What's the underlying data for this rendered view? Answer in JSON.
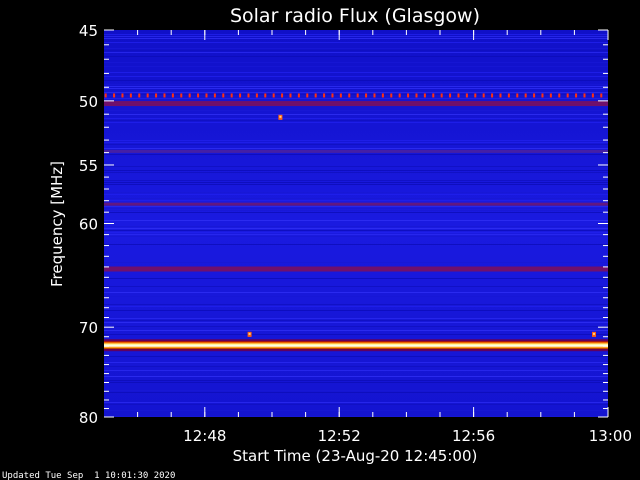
{
  "chart_data": {
    "type": "heatmap",
    "title": "Solar radio Flux (Glasgow)",
    "xlabel": "Start Time (23-Aug-20 12:45:00)",
    "ylabel": "Frequency [MHz]",
    "x_unit": "time (HH:MM)",
    "xlim": [
      "12:45",
      "13:00"
    ],
    "ylim": [
      45,
      80
    ],
    "y_scale": "log",
    "y_inverted": true,
    "x_ticks": [
      "12:48",
      "12:52",
      "12:56",
      "13:00"
    ],
    "y_ticks": [
      45,
      50,
      55,
      60,
      70,
      80
    ],
    "colormap": "blue-red-yellow-white",
    "background_level_color": "#1a1ad8",
    "persistent_bands_mhz": [
      {
        "freq": 50.2,
        "intensity": "strong",
        "color": "#7a1060"
      },
      {
        "freq": 53.9,
        "intensity": "medium",
        "color": "#4a20a0"
      },
      {
        "freq": 58.3,
        "intensity": "medium",
        "color": "#6a1878"
      },
      {
        "freq": 64.2,
        "intensity": "strong",
        "color": "#7a1060"
      },
      {
        "freq": 71.9,
        "intensity": "very strong",
        "color": "#ffffc0"
      }
    ],
    "periodic_bursts": {
      "freq": 49.6,
      "interval_min": 0.25,
      "color": "#ff3010"
    },
    "spot_events": [
      {
        "time": "12:50:15",
        "freq": 51.2
      },
      {
        "time": "12:49:20",
        "freq": 70.7
      },
      {
        "time": "12:59:35",
        "freq": 70.7
      }
    ]
  },
  "footer": {
    "updated": "Updated Tue Sep  1 10:01:30 2020"
  }
}
